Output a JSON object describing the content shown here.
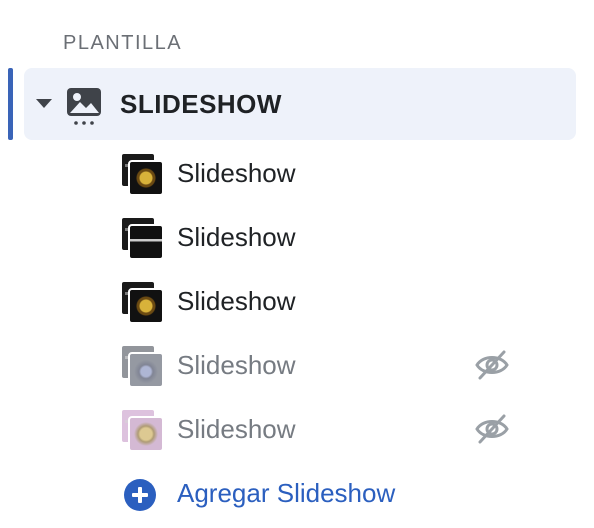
{
  "section_header": {
    "label": "PLANTILLA"
  },
  "section": {
    "title": "SLIDESHOW",
    "icon": "image-icon",
    "expanded": true
  },
  "blocks": [
    {
      "label": "Slideshow",
      "hidden": false
    },
    {
      "label": "Slideshow",
      "hidden": false
    },
    {
      "label": "Slideshow",
      "hidden": false
    },
    {
      "label": "Slideshow",
      "hidden": true,
      "status_icon": "eye-slash-icon"
    },
    {
      "label": "Slideshow",
      "hidden": true,
      "status_icon": "eye-slash-icon"
    }
  ],
  "add_block": {
    "label": "Agregar Slideshow",
    "icon": "plus-circle-icon"
  },
  "colors": {
    "accent": "#3a64b8",
    "link": "#2b5fbf",
    "selected_bg": "#eef2fa"
  }
}
